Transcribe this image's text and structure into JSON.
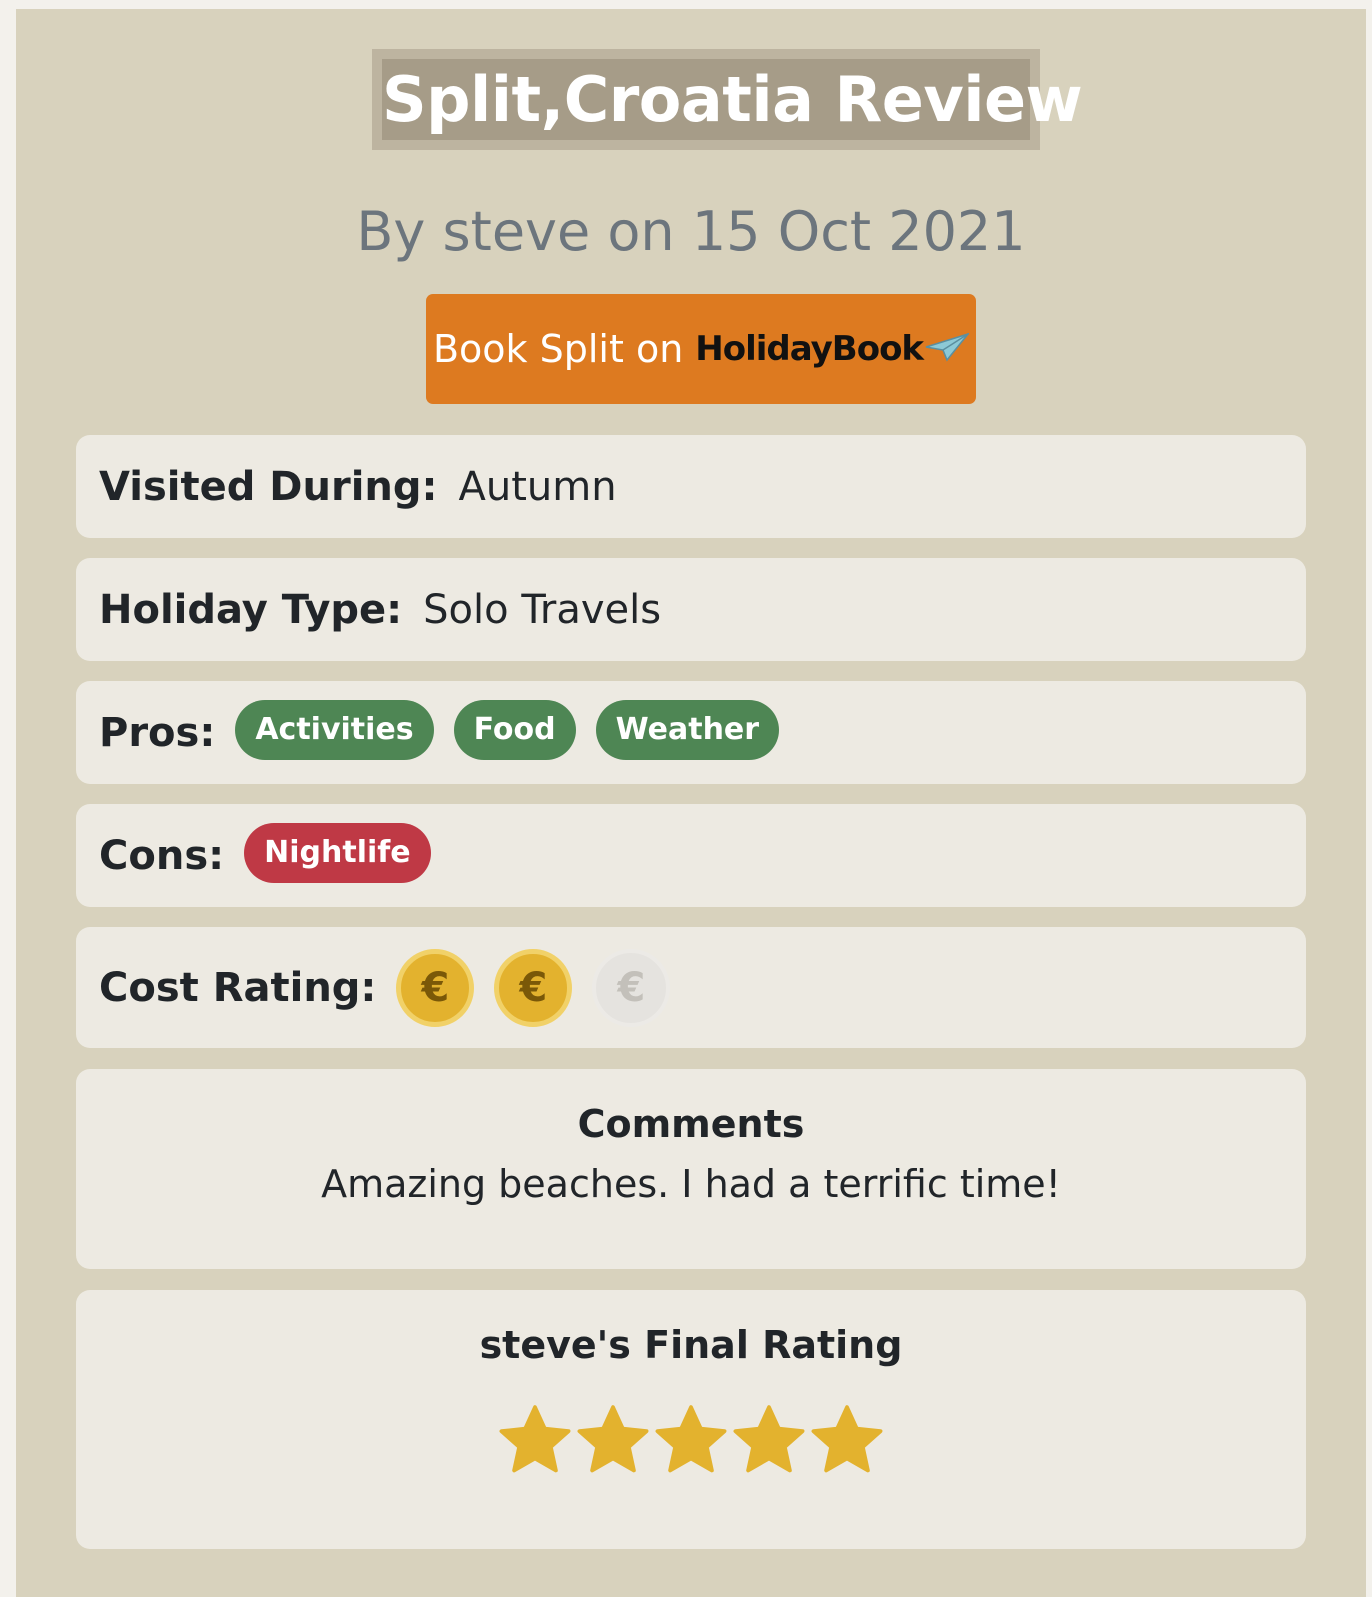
{
  "header": {
    "title": "Split,Croatia Review",
    "byline": "By steve on 15 Oct 2021"
  },
  "book_button": {
    "label": "Book Split on",
    "brand": "HolidayBook",
    "brand_icon": "paper-plane-icon",
    "color": "#dd7a20"
  },
  "details": {
    "visited_label": "Visited During:",
    "visited_value": "Autumn",
    "holiday_type_label": "Holiday Type:",
    "holiday_type_value": "Solo Travels",
    "pros_label": "Pros:",
    "pros": [
      "Activities",
      "Food",
      "Weather"
    ],
    "pros_color": "#4e8654",
    "cons_label": "Cons:",
    "cons": [
      "Nightlife"
    ],
    "cons_color": "#bf3945",
    "cost_label": "Cost Rating:",
    "cost_symbol": "€",
    "cost_rating": 2,
    "cost_max": 3
  },
  "comments": {
    "title": "Comments",
    "text": "Amazing beaches. I had a terrific time!"
  },
  "final_rating": {
    "title": "steve's Final Rating",
    "stars": 5,
    "max": 5,
    "star_color": "#e3b22e"
  }
}
